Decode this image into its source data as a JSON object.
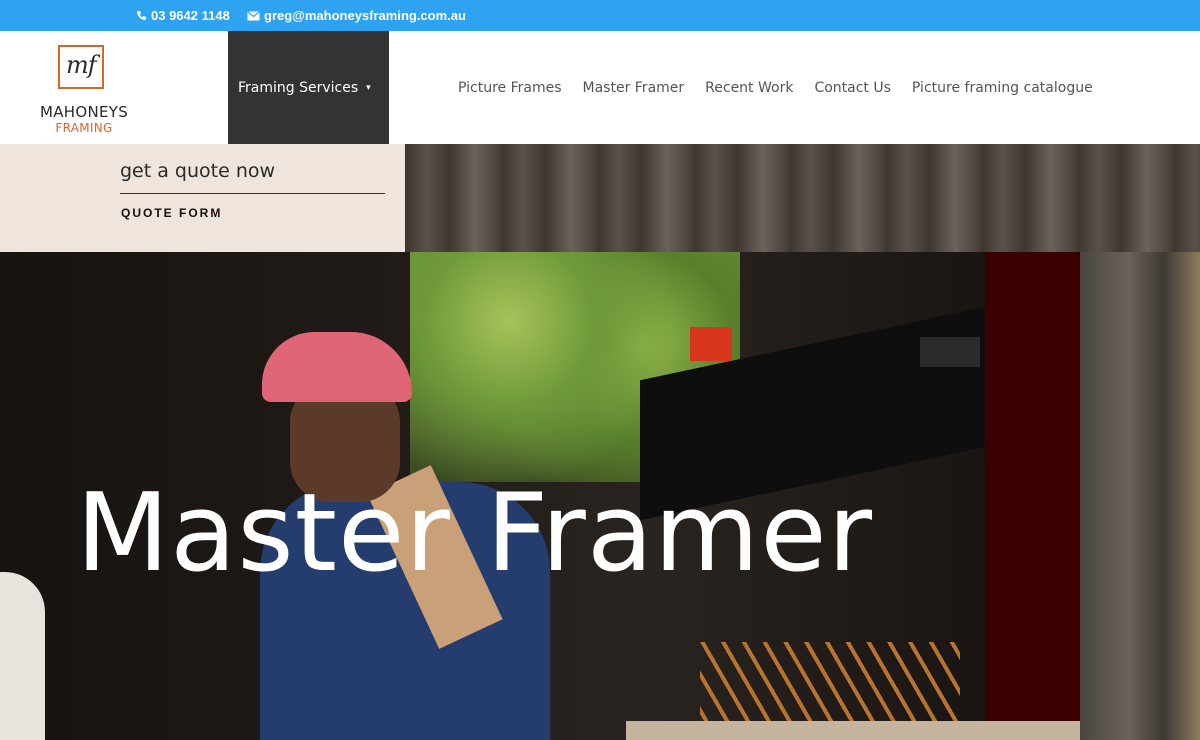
{
  "topbar": {
    "phone": "03 9642 1148",
    "email": "greg@mahoneysframing.com.au",
    "background_color": "#2ea3f2",
    "phone_icon": "phone-icon",
    "email_icon": "envelope-icon"
  },
  "logo": {
    "mark": "mf",
    "name": "MAHONEYS",
    "sub": "FRAMING",
    "accent_color": "#d9642a"
  },
  "nav": {
    "services_label": "Framing Services",
    "services_caret": "▾",
    "items": [
      "Picture Frames",
      "Master Framer",
      "Recent Work",
      "Contact Us",
      "Picture framing catalogue"
    ]
  },
  "quote": {
    "heading": "get a quote now",
    "link": "QUOTE FORM"
  },
  "hero": {
    "title": "Master Framer"
  }
}
